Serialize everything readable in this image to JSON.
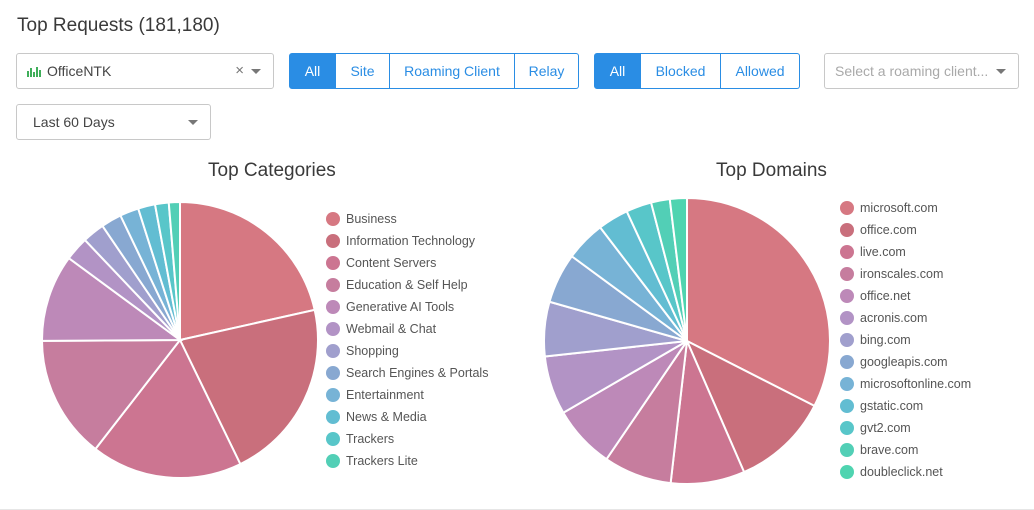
{
  "header": {
    "title": "Top Requests (181,180)"
  },
  "filters": {
    "organization": {
      "value": "OfficeNTK",
      "icon": "bar-chart-icon",
      "clear": "×"
    },
    "type_buttons": [
      {
        "label": "All",
        "active": true
      },
      {
        "label": "Site",
        "active": false
      },
      {
        "label": "Roaming Client",
        "active": false
      },
      {
        "label": "Relay",
        "active": false
      }
    ],
    "status_buttons": [
      {
        "label": "All",
        "active": true
      },
      {
        "label": "Blocked",
        "active": false
      },
      {
        "label": "Allowed",
        "active": false
      }
    ],
    "roaming_client": {
      "placeholder": "Select a roaming client..."
    },
    "date_range": {
      "value": "Last 60 Days"
    }
  },
  "chart_data": [
    {
      "type": "pie",
      "title": "Top Categories",
      "legend_position": "right",
      "categories": [
        "Business",
        "Information Technology",
        "Content Servers",
        "Education & Self Help",
        "Generative AI Tools",
        "Webmail & Chat",
        "Shopping",
        "Search Engines & Portals",
        "Entertainment",
        "News & Media",
        "Trackers",
        "Trackers Lite"
      ],
      "values": [
        21.5,
        21.3,
        17.7,
        14.4,
        10.2,
        2.8,
        2.6,
        2.4,
        2.2,
        2.0,
        1.6,
        1.3
      ],
      "colors": [
        "#d67882",
        "#c96f7c",
        "#cc7591",
        "#c67d9e",
        "#bd89b8",
        "#b293c5",
        "#a09fcd",
        "#88a8d1",
        "#77b3d6",
        "#62bdd2",
        "#58c6c9",
        "#52cfb6"
      ]
    },
    {
      "type": "pie",
      "title": "Top Domains",
      "legend_position": "right",
      "categories": [
        "microsoft.com",
        "office.com",
        "live.com",
        "ironscales.com",
        "office.net",
        "acronis.com",
        "bing.com",
        "googleapis.com",
        "microsoftonline.com",
        "gstatic.com",
        "gvt2.com",
        "brave.com",
        "doubleclick.net"
      ],
      "values": [
        33.8,
        11.4,
        8.7,
        8.0,
        7.4,
        6.9,
        6.4,
        5.9,
        4.7,
        3.6,
        3.0,
        2.2,
        2.0
      ],
      "colors": [
        "#d67882",
        "#c96f7c",
        "#cc7591",
        "#c67d9e",
        "#bd89b8",
        "#b293c5",
        "#a09fcd",
        "#88a8d1",
        "#77b3d6",
        "#62bdd2",
        "#58c6c9",
        "#52cfb6",
        "#4fd4b0"
      ]
    }
  ]
}
